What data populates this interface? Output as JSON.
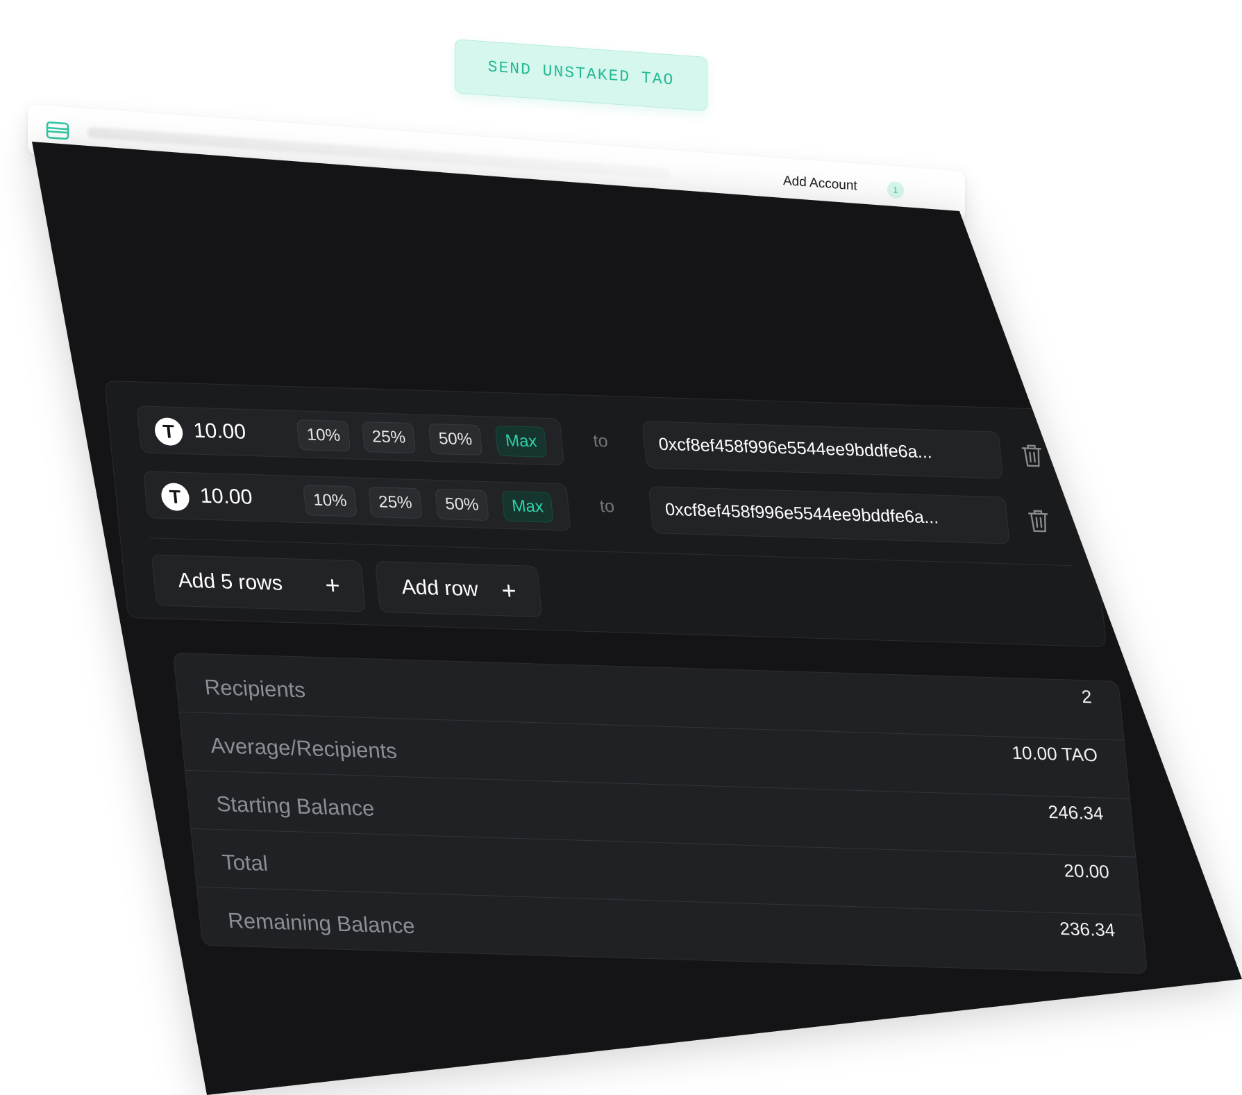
{
  "header": {
    "title": "SEND UNSTAKED TAO",
    "add_account_label": "Add Account",
    "account_count": "1",
    "wallet_icon": "wallet-icon"
  },
  "rows": [
    {
      "amount": "10.00",
      "token_icon": "tao-icon",
      "token_symbol": "T",
      "pct_10": "10%",
      "pct_25": "25%",
      "pct_50": "50%",
      "pct_max": "Max",
      "to_label": "to",
      "address": "0xcf8ef458f996e5544ee9bddfe6a..."
    },
    {
      "amount": "10.00",
      "token_icon": "tao-icon",
      "token_symbol": "T",
      "pct_10": "10%",
      "pct_25": "25%",
      "pct_50": "50%",
      "pct_max": "Max",
      "to_label": "to",
      "address": "0xcf8ef458f996e5544ee9bddfe6a..."
    }
  ],
  "actions": {
    "add_five_label": "Add 5 rows",
    "add_one_label": "Add row",
    "plus_symbol": "+"
  },
  "summary": {
    "rows": [
      {
        "label": "Recipients",
        "value": "2"
      },
      {
        "label": "Average/Recipients",
        "value": "10.00 TAO"
      },
      {
        "label": "Starting Balance",
        "value": "246.34"
      },
      {
        "label": "Total",
        "value": "20.00"
      },
      {
        "label": "Remaining Balance",
        "value": "236.34"
      }
    ]
  },
  "colors": {
    "accent": "#2fc9a6",
    "card_bg": "#141416",
    "panel_bg": "#1a1b1d"
  }
}
